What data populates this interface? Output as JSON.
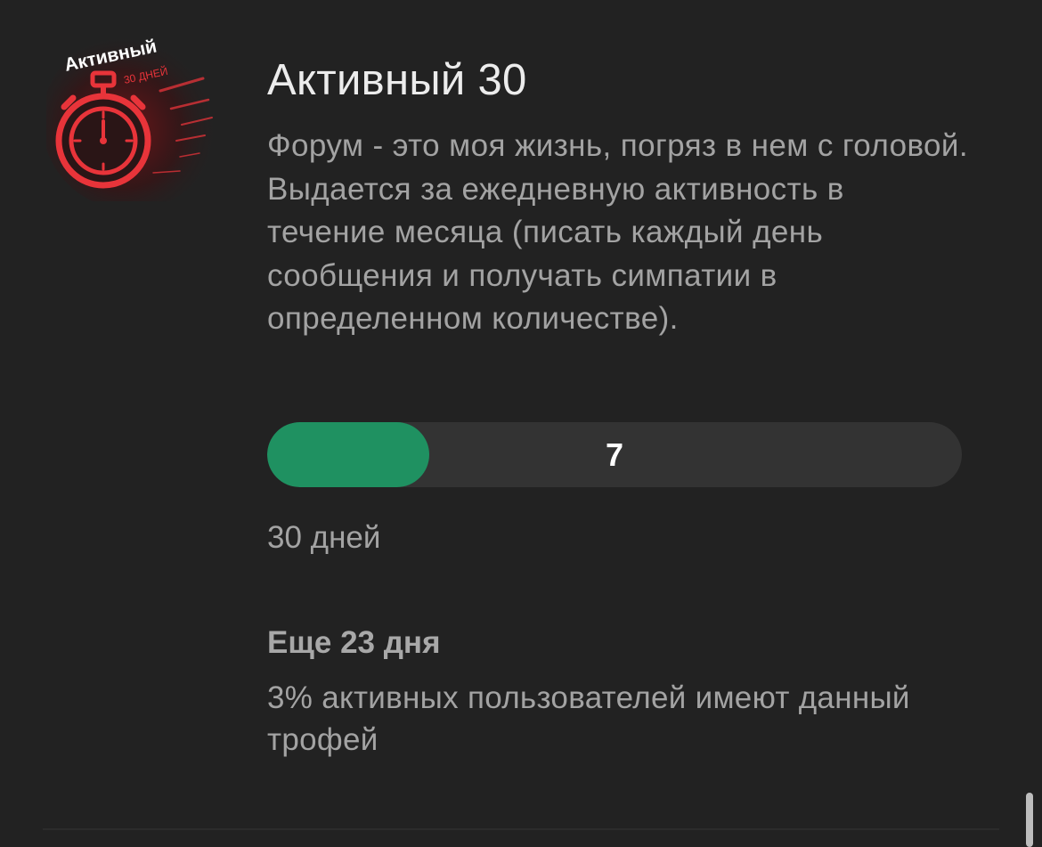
{
  "trophy": {
    "icon": "stopwatch-icon",
    "badge_title": "Активный",
    "badge_subtitle": "30 ДНЕЙ",
    "title": "Активный 30",
    "description": "Форум - это моя жизнь, погряз в нем с головой. Выдается за ежедневную активность в течение месяца (писать каждый день сообщения и получать симпатии в определенном количестве)."
  },
  "progress": {
    "value": "7",
    "fraction": 0.233,
    "goal_label": "30 дней",
    "remaining_label": "Еще 23 дня"
  },
  "stats": {
    "owners_text": "3% активных пользователей имеют данный трофей"
  },
  "colors": {
    "background": "#222222",
    "progress_fill": "#1f9161",
    "progress_track": "#333333",
    "badge_red": "#e8343a"
  }
}
